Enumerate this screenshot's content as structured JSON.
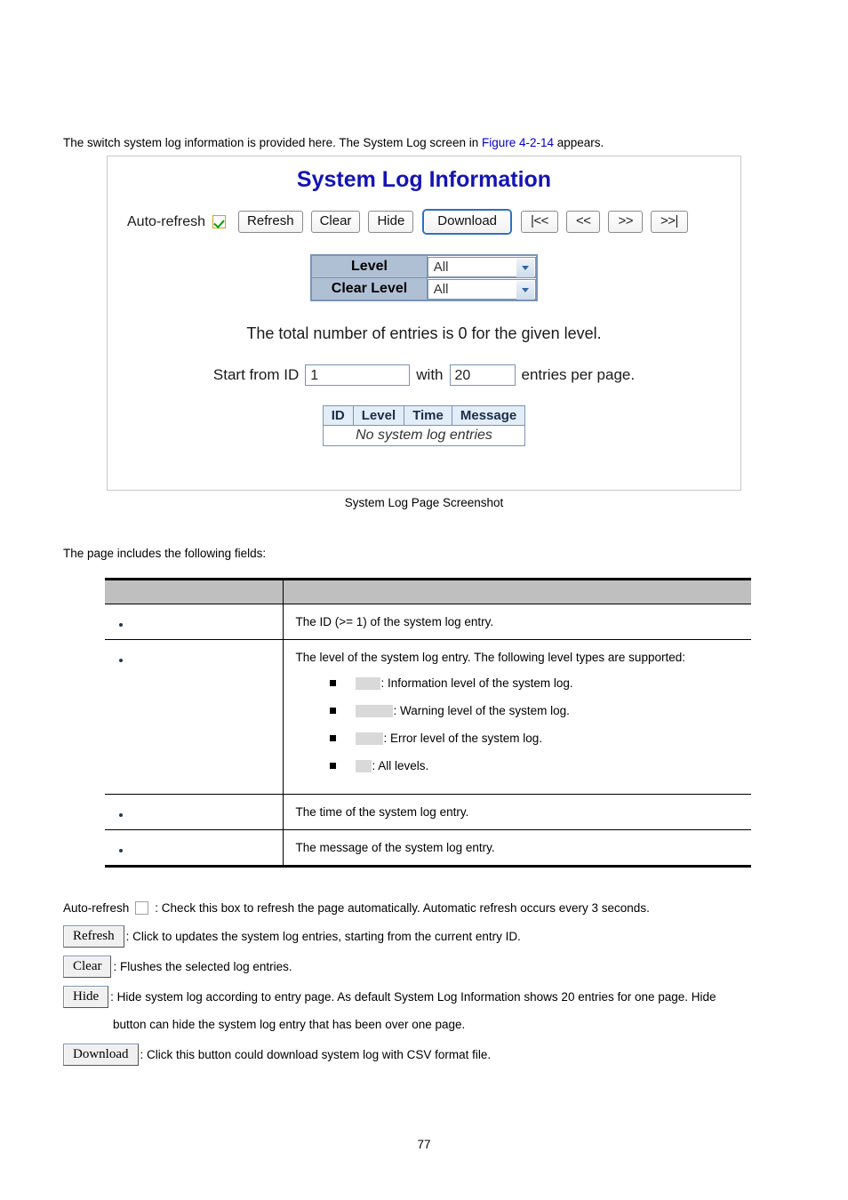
{
  "intro": {
    "before_link": "The switch system log information is provided here. The System Log screen in ",
    "link": "Figure 4-2-14",
    "after_link": " appears."
  },
  "figure": {
    "title": "System Log Information",
    "toolbar": {
      "auto_refresh_label": "Auto-refresh",
      "auto_refresh_checked": true,
      "refresh": "Refresh",
      "clear": "Clear",
      "hide": "Hide",
      "download": "Download",
      "nav_first": "|<<",
      "nav_prev": "<<",
      "nav_next": ">>",
      "nav_last": ">>|"
    },
    "filters": [
      {
        "label": "Level",
        "value": "All"
      },
      {
        "label": "Clear Level",
        "value": "All"
      }
    ],
    "total_text": "The total number of entries is 0 for the given level.",
    "paging": {
      "start_label": "Start from ID",
      "start_value": "1",
      "with_label": "with",
      "count_value": "20",
      "suffix_label": "entries per page."
    },
    "log_table": {
      "headers": [
        "ID",
        "Level",
        "Time",
        "Message"
      ],
      "empty_message": "No system log entries"
    },
    "caption": "System Log Page Screenshot"
  },
  "includes_text": "The page includes the following fields:",
  "field_table": {
    "header": {
      "col1": "",
      "col2": ""
    },
    "rows": [
      {
        "label": "",
        "desc": "The ID (>= 1) of the system log entry."
      },
      {
        "label": "",
        "desc": "The level of the system log entry. The following level types are supported:",
        "levels": [
          {
            "placeholder_width": 28,
            "text": ": Information level of the system log."
          },
          {
            "placeholder_width": 42,
            "text": ": Warning level of the system log."
          },
          {
            "placeholder_width": 31,
            "text": ": Error level of the system log."
          },
          {
            "placeholder_width": 18,
            "text": ": All levels."
          }
        ]
      },
      {
        "label": "",
        "desc": "The time of the system log entry."
      },
      {
        "label": "",
        "desc": "The message of the system log entry."
      }
    ]
  },
  "descriptions": {
    "auto_refresh_prefix": "Auto-refresh",
    "auto_refresh_text": ": Check this box to refresh the page automatically. Automatic refresh occurs every 3 seconds.",
    "refresh_btn": "Refresh",
    "refresh_text": ": Click to updates the system log entries, starting from the current entry ID.",
    "clear_btn": "Clear",
    "clear_text": ": Flushes the selected log entries.",
    "hide_btn": "Hide",
    "hide_text": ": Hide system log according to entry page. As default System Log Information shows 20 entries for one page. Hide",
    "hide_text_cont": "button can hide the system log entry that has been over one page.",
    "download_btn": "Download",
    "download_text": ": Click this button could download system log with CSV format file."
  },
  "page_number": "77"
}
